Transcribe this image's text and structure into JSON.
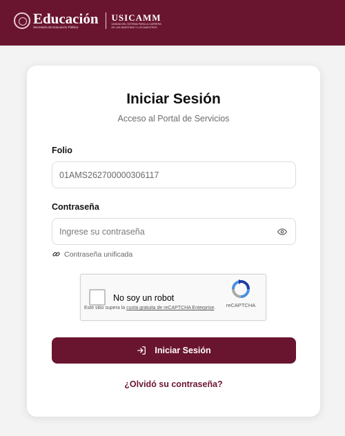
{
  "header": {
    "brand_name": "Educación",
    "brand_subtitle": "Secretaría de Educación Pública",
    "org_name": "USICAMM",
    "org_subtitle_line1": "UNIDAD DEL SISTEMA PARA LA CARRERA",
    "org_subtitle_line2": "DE LAS MAESTRAS Y LOS MAESTROS",
    "logo_icon": "government-seal-icon",
    "bar_color": "#6a1530"
  },
  "card": {
    "title": "Iniciar Sesión",
    "subtitle": "Acceso al Portal de Servicios"
  },
  "form": {
    "folio_label": "Folio",
    "folio_value": "01AMS262700000306117",
    "password_label": "Contraseña",
    "password_placeholder": "Ingrese su contraseña",
    "password_toggle_icon": "eye-icon",
    "unified_password_text": "Contraseña unificada",
    "unified_password_icon": "linked-key-icon"
  },
  "captcha": {
    "checkbox_label": "No soy un robot",
    "note_prefix": "Este sitio supera la",
    "note_link": "cuota gratuita de reCAPTCHA Enterprise",
    "note_suffix": ".",
    "brand": "reCAPTCHA"
  },
  "actions": {
    "submit_label": "Iniciar Sesión",
    "submit_icon": "login-arrow-icon",
    "forgot_label": "¿Olvidó su contraseña?",
    "accent_color": "#6a1530"
  }
}
